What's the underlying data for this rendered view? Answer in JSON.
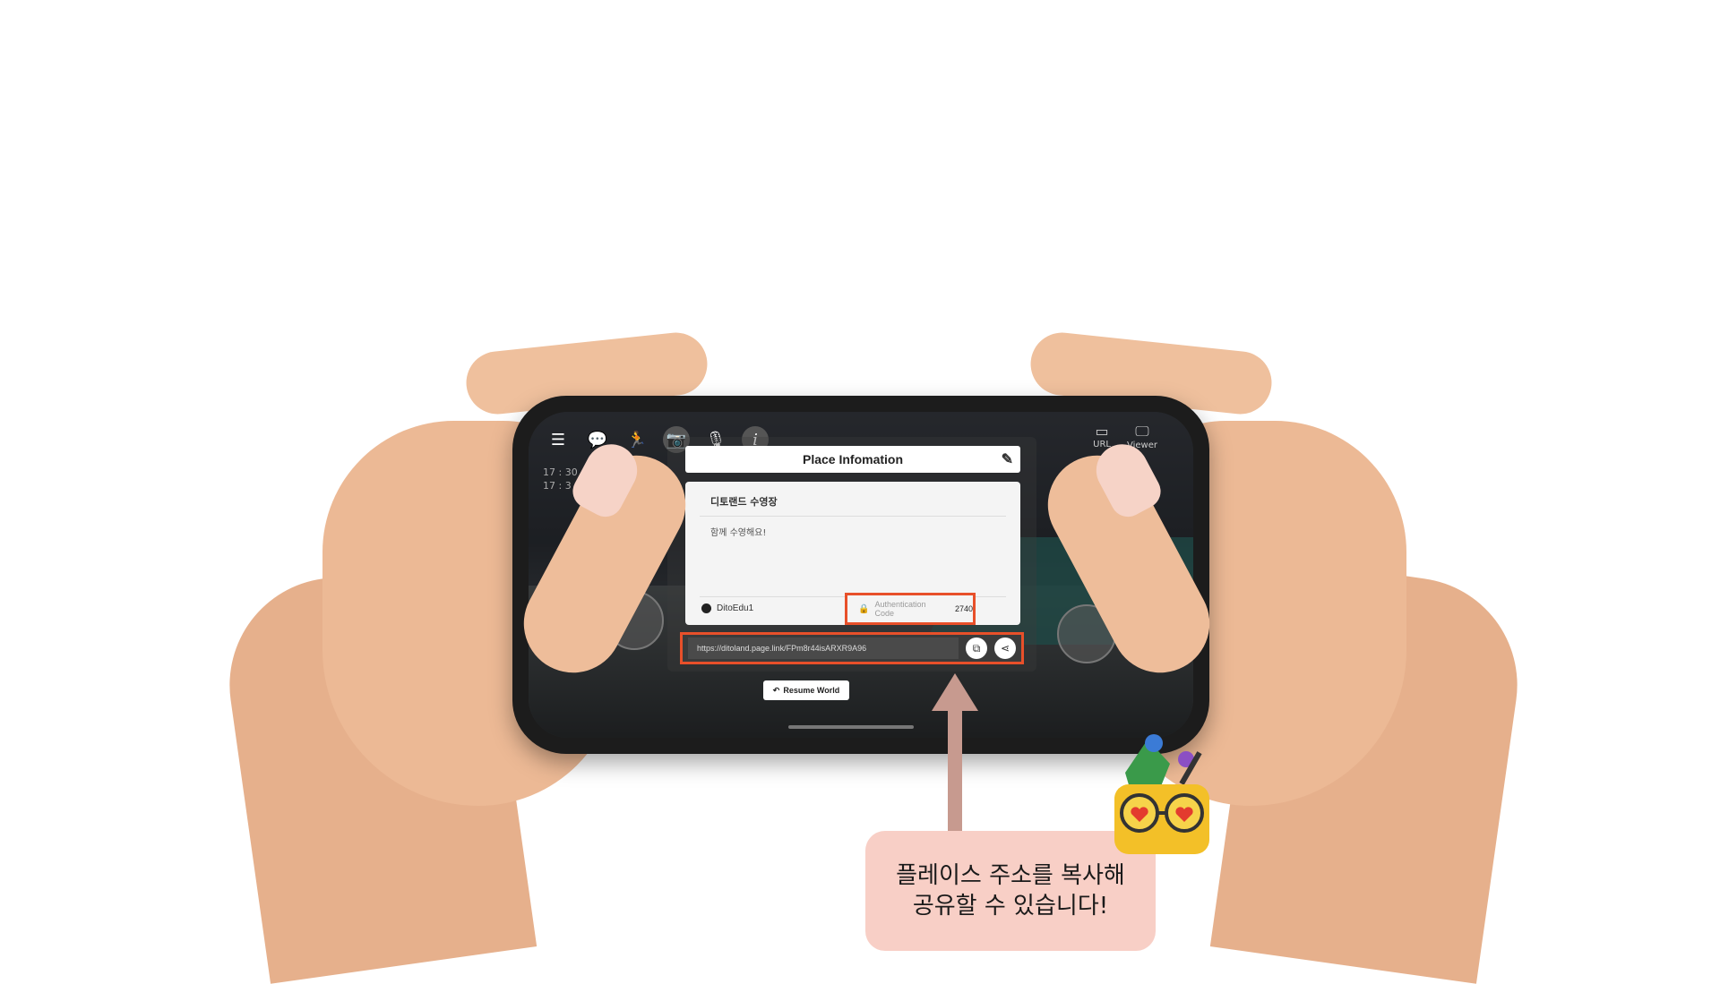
{
  "toolbar": {
    "icons": [
      "menu-icon",
      "chat-icon",
      "emote-icon",
      "camera-icon",
      "mic-off-icon",
      "info-icon"
    ]
  },
  "chat_log": {
    "times": [
      "17 : 30",
      "17 : 3"
    ]
  },
  "top_right": {
    "url_label": "URL",
    "viewer_label": "Viewer"
  },
  "dialog": {
    "title": "Place Infomation",
    "place_name": "디토랜드 수영장",
    "description": "함께 수영해요!",
    "owner": "DitoEdu1",
    "auth_label": "Authentication Code",
    "auth_code": "2740",
    "link": "https://ditoland.page.link/FPm8r44isARXR9A96"
  },
  "resume_button": "Resume World",
  "callout": {
    "line1": "플레이스 주소를 복사해",
    "line2": "공유할 수 있습니다!"
  },
  "colors": {
    "highlight": "#e8502a",
    "callout_bg": "#f8cfc6",
    "arrow": "#c79a8f"
  }
}
